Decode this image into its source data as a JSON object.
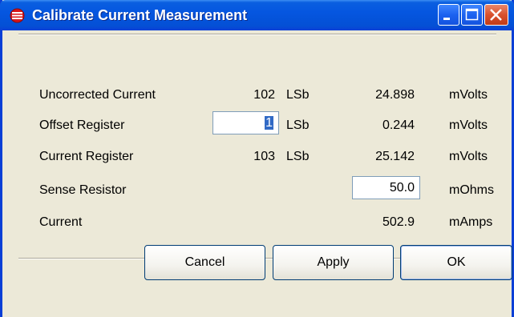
{
  "window": {
    "title": "Calibrate Current Measurement"
  },
  "title_buttons": {
    "minimize": "minimize-icon",
    "maximize": "maximize-icon",
    "close": "close-icon"
  },
  "rows": [
    {
      "label": "Uncorrected Current",
      "lsb_value": "102",
      "lsb_unit": "LSb",
      "value": "24.898",
      "unit": "mVolts"
    },
    {
      "label": "Offset Register",
      "lsb_value": "1",
      "lsb_unit": "LSb",
      "value": "0.244",
      "unit": "mVolts"
    },
    {
      "label": "Current Register",
      "lsb_value": "103",
      "lsb_unit": "LSb",
      "value": "25.142",
      "unit": "mVolts"
    },
    {
      "label": "Sense Resistor",
      "value": "50.0",
      "unit": "mOhms"
    },
    {
      "label": "Current",
      "value": "502.9",
      "unit": "mAmps"
    }
  ],
  "buttons": {
    "cancel": "Cancel",
    "apply": "Apply",
    "ok": "OK"
  },
  "colors": {
    "titlebar": "#0556e0",
    "dialog_bg": "#ece9d8",
    "selection": "#316ac5"
  }
}
